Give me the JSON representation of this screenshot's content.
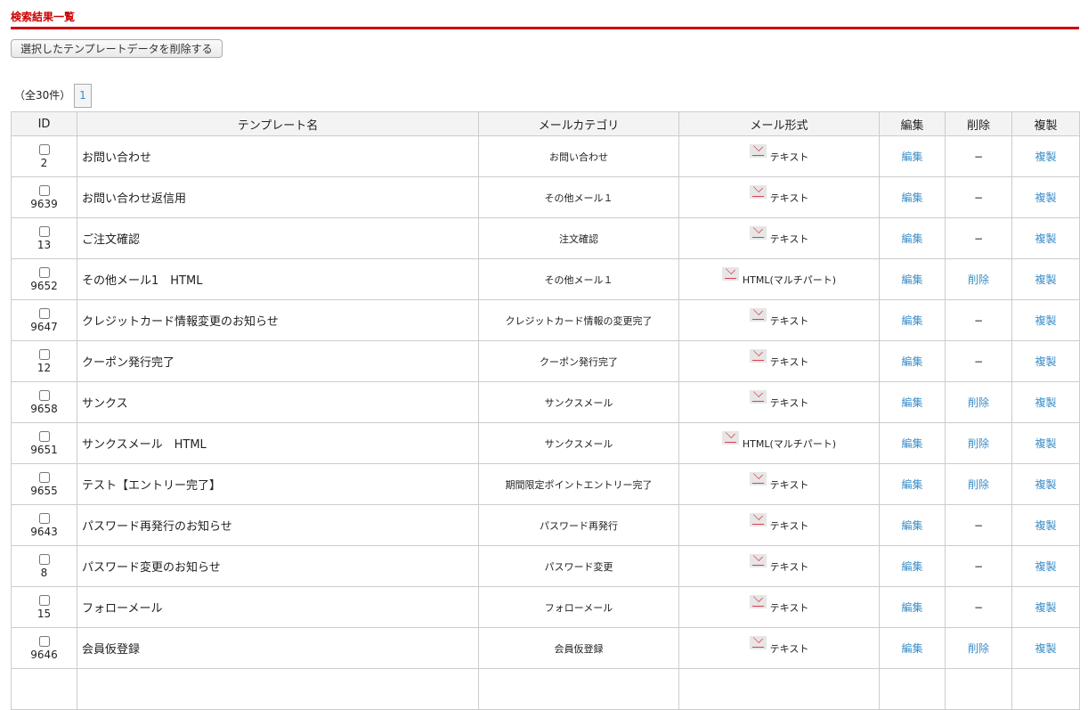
{
  "title": "検索結果一覧",
  "delete_selected_label": "選択したテンプレートデータを削除する",
  "count_label": "（全30件）",
  "page": "1",
  "headers": {
    "id": "ID",
    "name": "テンプレート名",
    "category": "メールカテゴリ",
    "format": "メール形式",
    "edit": "編集",
    "delete": "削除",
    "copy": "複製"
  },
  "rows": [
    {
      "id": "2",
      "name": "お問い合わせ",
      "category": "お問い合わせ",
      "format": "テキスト",
      "edit": "編集",
      "delete": "−",
      "copy": "複製"
    },
    {
      "id": "9639",
      "name": "お問い合わせ返信用",
      "category": "その他メール１",
      "format": "テキスト",
      "edit": "編集",
      "delete": "−",
      "copy": "複製"
    },
    {
      "id": "13",
      "name": "ご注文確認",
      "category": "注文確認",
      "format": "テキスト",
      "edit": "編集",
      "delete": "−",
      "copy": "複製"
    },
    {
      "id": "9652",
      "name": "その他メール1　HTML",
      "category": "その他メール１",
      "format": "HTML(マルチパート)",
      "edit": "編集",
      "delete": "削除",
      "copy": "複製"
    },
    {
      "id": "9647",
      "name": "クレジットカード情報変更のお知らせ",
      "category": "クレジットカード情報の変更完了",
      "format": "テキスト",
      "edit": "編集",
      "delete": "−",
      "copy": "複製"
    },
    {
      "id": "12",
      "name": "クーポン発行完了",
      "category": "クーポン発行完了",
      "format": "テキスト",
      "edit": "編集",
      "delete": "−",
      "copy": "複製"
    },
    {
      "id": "9658",
      "name": "サンクス",
      "category": "サンクスメール",
      "format": "テキスト",
      "edit": "編集",
      "delete": "削除",
      "copy": "複製"
    },
    {
      "id": "9651",
      "name": "サンクスメール　HTML",
      "category": "サンクスメール",
      "format": "HTML(マルチパート)",
      "edit": "編集",
      "delete": "削除",
      "copy": "複製"
    },
    {
      "id": "9655",
      "name": "テスト【エントリー完了】",
      "category": "期間限定ポイントエントリー完了",
      "format": "テキスト",
      "edit": "編集",
      "delete": "削除",
      "copy": "複製"
    },
    {
      "id": "9643",
      "name": "パスワード再発行のお知らせ",
      "category": "パスワード再発行",
      "format": "テキスト",
      "edit": "編集",
      "delete": "−",
      "copy": "複製"
    },
    {
      "id": "8",
      "name": "パスワード変更のお知らせ",
      "category": "パスワード変更",
      "format": "テキスト",
      "edit": "編集",
      "delete": "−",
      "copy": "複製"
    },
    {
      "id": "15",
      "name": "フォローメール",
      "category": "フォローメール",
      "format": "テキスト",
      "edit": "編集",
      "delete": "−",
      "copy": "複製"
    },
    {
      "id": "9646",
      "name": "会員仮登録",
      "category": "会員仮登録",
      "format": "テキスト",
      "edit": "編集",
      "delete": "削除",
      "copy": "複製"
    }
  ]
}
